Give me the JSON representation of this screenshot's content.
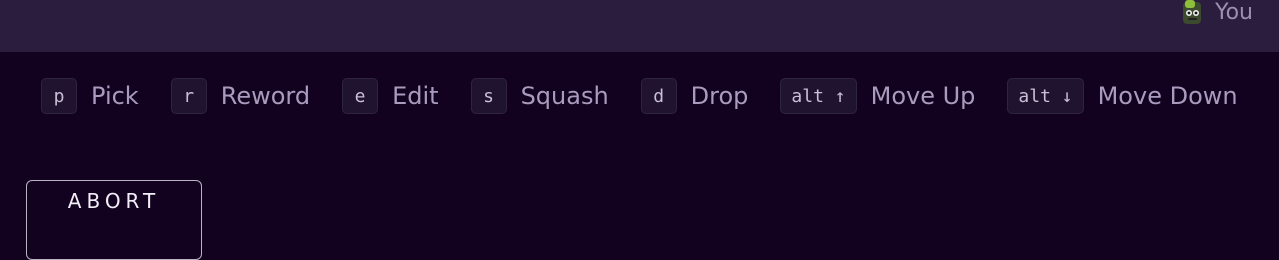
{
  "header": {
    "user_name": "You",
    "avatar_icon": "user-avatar-icon"
  },
  "shortcuts": [
    {
      "key": "p",
      "action": "Pick"
    },
    {
      "key": "r",
      "action": "Reword"
    },
    {
      "key": "e",
      "action": "Edit"
    },
    {
      "key": "s",
      "action": "Squash"
    },
    {
      "key": "d",
      "action": "Drop"
    },
    {
      "key": "alt ↑",
      "action": "Move Up"
    },
    {
      "key": "alt ↓",
      "action": "Move Down"
    }
  ],
  "buttons": {
    "abort_label": "ABORT"
  },
  "colors": {
    "background": "#12021f",
    "header_background": "#2b1d3d",
    "text_muted": "#a99bbd"
  }
}
